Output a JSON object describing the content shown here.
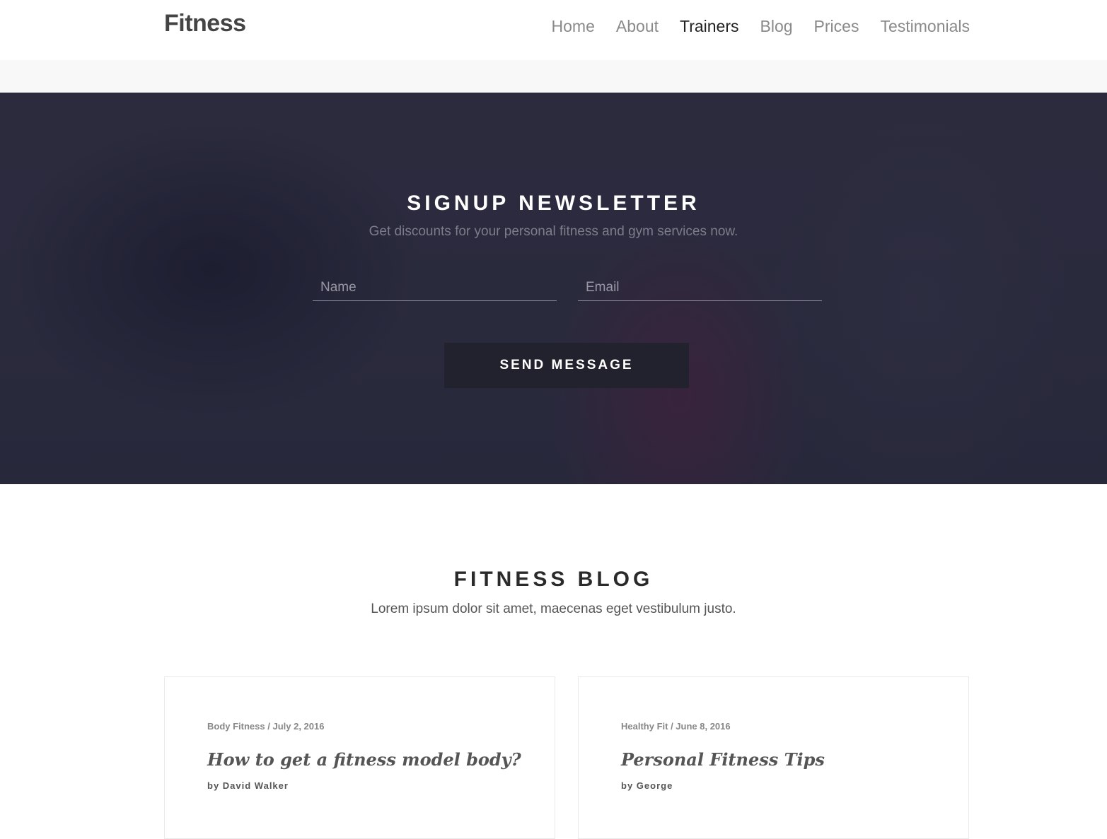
{
  "header": {
    "logo": "Fitness",
    "nav": [
      "Home",
      "About",
      "Trainers",
      "Blog",
      "Prices",
      "Testimonials"
    ],
    "active_nav": "Trainers"
  },
  "newsletter": {
    "title": "SIGNUP NEWSLETTER",
    "subtitle": "Get discounts for your personal fitness and gym services now.",
    "name_placeholder": "Name",
    "email_placeholder": "Email",
    "button_label": "SEND MESSAGE"
  },
  "blog": {
    "title": "FITNESS BLOG",
    "subtitle": "Lorem ipsum dolor sit amet, maecenas eget vestibulum justo.",
    "posts": [
      {
        "category": "Body Fitness",
        "date": "July 2, 2016",
        "meta": "Body Fitness / July 2, 2016",
        "title": "How to get a fitness model body?",
        "author": "by David Walker"
      },
      {
        "category": "Healthy Fit",
        "date": "June 8, 2016",
        "meta": "Healthy Fit / June 8, 2016",
        "title": "Personal Fitness Tips",
        "author": "by George"
      }
    ]
  }
}
